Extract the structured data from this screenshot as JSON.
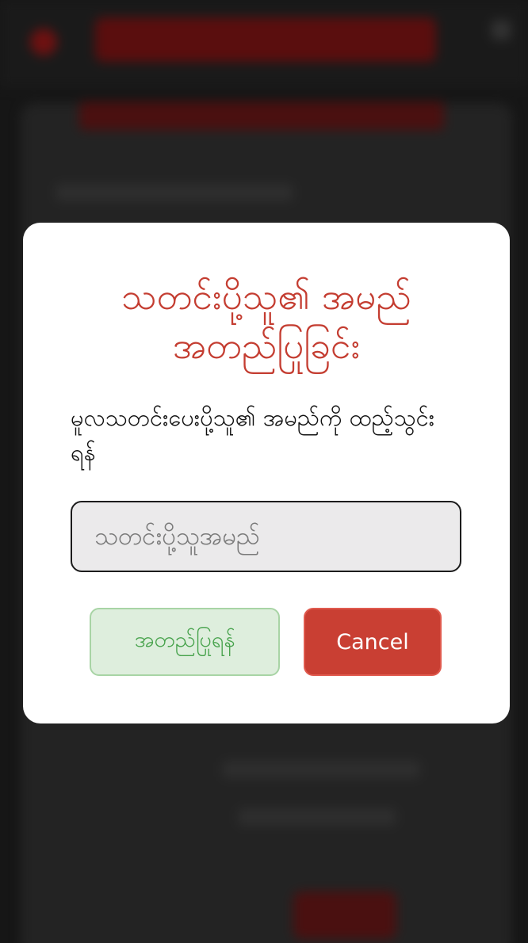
{
  "dialog": {
    "title": "သတင်းပို့သူ၏ အမည် အတည်ပြုခြင်း",
    "message": "မူလသတင်းပေးပို့သူ၏ အမည်ကို ထည့်သွင်းရန်",
    "name_input": {
      "value": "",
      "placeholder": "သတင်းပို့သူအမည်"
    },
    "confirm_label": "အတည်ပြုရန်",
    "cancel_label": "Cancel"
  },
  "colors": {
    "title": "#c43d31",
    "confirm_bg": "#deeedd",
    "confirm_text": "#46a24b",
    "cancel_bg": "#c93f33",
    "overlay": "#161616"
  }
}
